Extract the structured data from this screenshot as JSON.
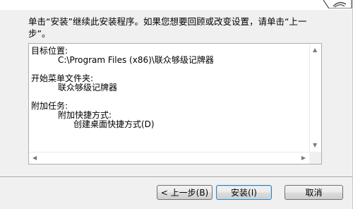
{
  "intro": {
    "line1": "单击“安装”继续此安装程序。如果您想要回顾或改变设置，请单击“上一",
    "line2": "步”。"
  },
  "summary": {
    "target_label": "目标位置:",
    "target_value": "C:\\Program Files (x86)\\联众够级记牌器",
    "menu_label": "开始菜单文件夹:",
    "menu_value": "联众够级记牌器",
    "tasks_label": "附加任务:",
    "tasks_group": "附加快捷方式:",
    "tasks_item": "创建桌面快捷方式(D)"
  },
  "buttons": {
    "back": "< 上一步(B)",
    "install": "安装(I)",
    "cancel": "取消"
  }
}
